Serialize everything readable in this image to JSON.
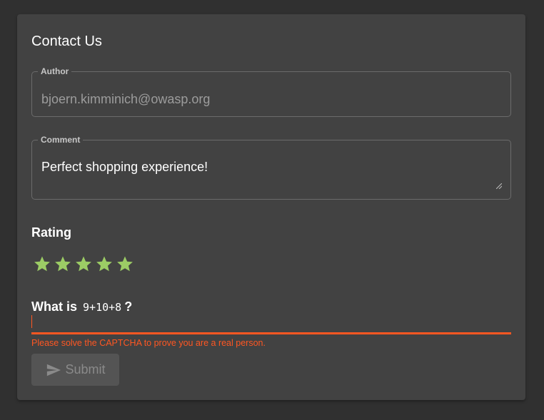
{
  "form": {
    "title": "Contact Us",
    "author": {
      "label": "Author",
      "value": "bjoern.kimminich@owasp.org"
    },
    "comment": {
      "label": "Comment",
      "value": "Perfect shopping experience!"
    },
    "rating": {
      "label": "Rating",
      "value": 5,
      "max": 5,
      "star_color": "#9ccc65"
    },
    "captcha": {
      "prefix": "What is",
      "expression": "9+10+8",
      "suffix": "?",
      "value": "",
      "error": "Please solve the CAPTCHA to prove you are a real person.",
      "accent_color": "#ff5722"
    },
    "submit": {
      "label": "Submit",
      "icon": "send-icon",
      "disabled": true
    }
  }
}
